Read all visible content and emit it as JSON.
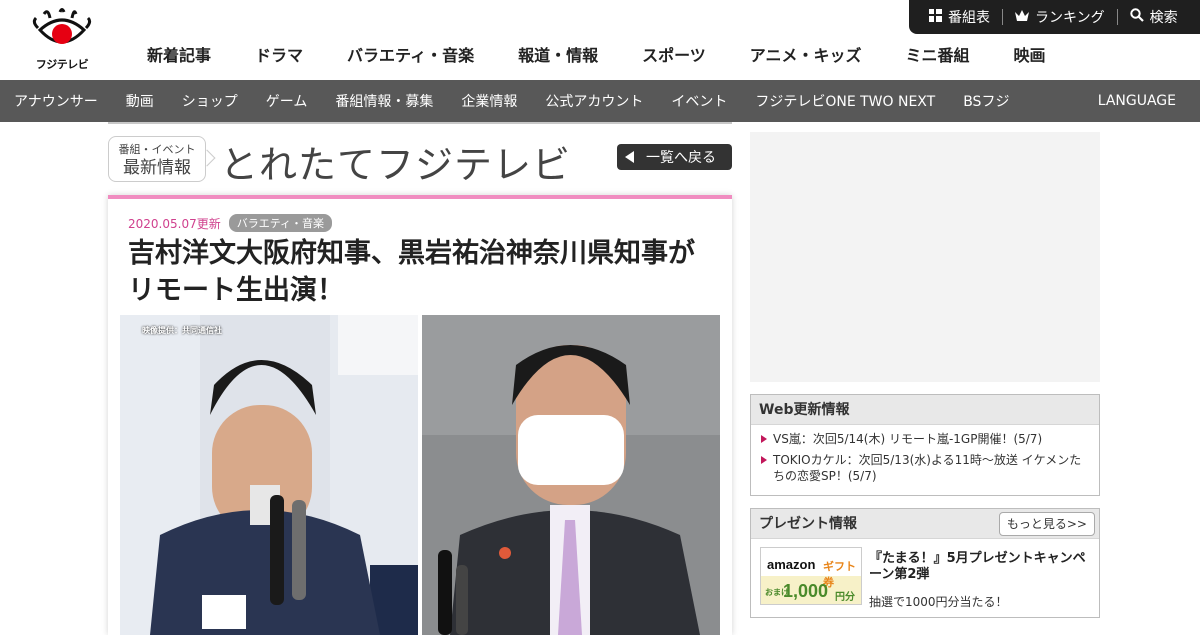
{
  "header": {
    "logo_text": "フジテレビ",
    "utility": [
      {
        "icon": "grid-icon",
        "label": "番組表"
      },
      {
        "icon": "crown-icon",
        "label": "ランキング"
      },
      {
        "icon": "search-icon",
        "label": "検索"
      }
    ],
    "main_nav": [
      "新着記事",
      "ドラマ",
      "バラエティ・音楽",
      "報道・情報",
      "スポーツ",
      "アニメ・キッズ",
      "ミニ番組",
      "映画"
    ]
  },
  "sub_nav": {
    "items": [
      "アナウンサー",
      "動画",
      "ショップ",
      "ゲーム",
      "番組情報・募集",
      "企業情報",
      "公式アカウント",
      "イベント",
      "フジテレビONE TWO NEXT",
      "BSフジ"
    ],
    "language": "LANGUAGE"
  },
  "section": {
    "badge_line1": "番組・イベント",
    "badge_line2": "最新情報",
    "title": "とれたてフジテレビ",
    "back_label": "一覧へ戻る"
  },
  "article": {
    "date": "2020.05.07更新",
    "category": "バラエティ・音楽",
    "headline": "吉村洋文大阪府知事、黒岩祐治神奈川県知事がリモート生出演！",
    "photo_credit": "映像提供：共同通信社"
  },
  "sidebar": {
    "web_update": {
      "title": "Web更新情報",
      "items": [
        "VS嵐：次回5/14(木) リモート嵐-1GP開催！(5/7)",
        "TOKIOカケル：次回5/13(水)よる11時～放送 イケメンたちの恋愛SP！(5/7)"
      ]
    },
    "present": {
      "title": "プレゼント情報",
      "more": "もっと見る>>",
      "thumb_brand": "amazon",
      "thumb_label": "ギフト券",
      "thumb_small": "おまけ",
      "thumb_amount": "1,000",
      "thumb_unit": "円分",
      "item_title": "『たまる！』5月プレゼントキャンペーン第2弾",
      "item_desc": "抽選で1000円分当たる！"
    }
  },
  "colors": {
    "accent_pink": "#f08cc0",
    "date_pink": "#d0418e",
    "subnav_bg": "#585858",
    "utility_bg": "#1f1f1f",
    "logo_red": "#e60012"
  }
}
